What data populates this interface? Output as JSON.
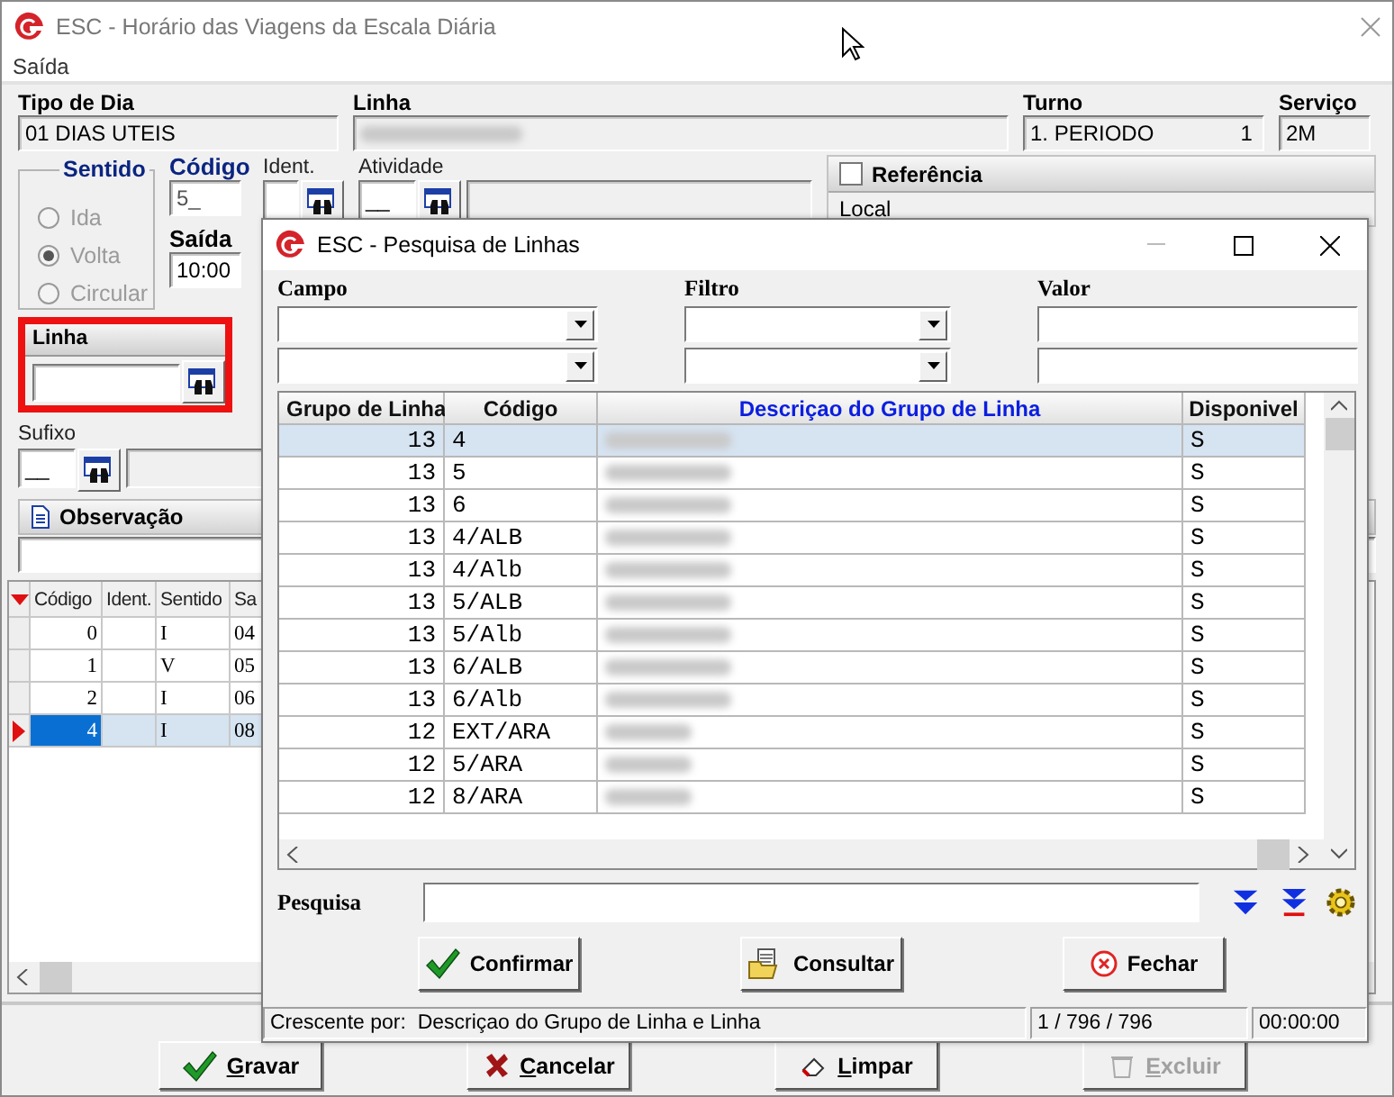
{
  "main_window": {
    "title": "ESC - Horário das Viagens da Escala Diária",
    "menu": [
      "Saída"
    ],
    "header_fields": [
      {
        "label": "Tipo de Dia",
        "value": "01 DIAS UTEIS",
        "blurred": false
      },
      {
        "label": "Linha",
        "blurred": true
      },
      {
        "label": "Turno",
        "value": "1. PERIODO",
        "extra": "1",
        "blurred": false
      },
      {
        "label": "Serviço",
        "value": "2M",
        "blurred": false
      }
    ],
    "sentido": {
      "title": "Sentido",
      "disabled": true,
      "options": [
        {
          "label": "Ida",
          "selected": false
        },
        {
          "label": "Volta",
          "selected": true
        },
        {
          "label": "Circular",
          "selected": false
        }
      ]
    },
    "codigo": {
      "label": "Código",
      "value": "5_"
    },
    "saida": {
      "label": "Saída",
      "value": "10:00"
    },
    "ident": {
      "label": "Ident."
    },
    "atividade": {
      "label": "Atividade",
      "value": "__"
    },
    "referencia": {
      "label": "Referência",
      "checked": false,
      "local": "Local"
    },
    "linha_panel": {
      "title": "Linha",
      "highlighted": true
    },
    "sufixo": {
      "label": "Sufixo",
      "value": "__"
    },
    "observacao": {
      "title": "Observação"
    },
    "grid": {
      "columns": [
        "Código",
        "Ident.",
        "Sentido",
        "Sa"
      ],
      "rows": [
        {
          "codigo": "0",
          "sentido": "I",
          "column_4": "04",
          "selected": false
        },
        {
          "codigo": "1",
          "sentido": "V",
          "column_4": "05",
          "selected": false
        },
        {
          "codigo": "2",
          "sentido": "I",
          "column_4": "06",
          "selected": false
        },
        {
          "codigo": "4",
          "sentido": "I",
          "column_4": "08",
          "selected": true
        }
      ]
    },
    "buttons": [
      {
        "label": "Gravar",
        "kind": "save",
        "disabled": false
      },
      {
        "label": "Cancelar",
        "kind": "cancel",
        "disabled": false
      },
      {
        "label": "Limpar",
        "kind": "clear",
        "disabled": false
      },
      {
        "label": "Excluir",
        "kind": "delete",
        "disabled": true
      }
    ]
  },
  "dialog": {
    "title": "ESC - Pesquisa de Linhas",
    "filter_labels": [
      "Campo",
      "Filtro",
      "Valor"
    ],
    "table": {
      "columns": [
        {
          "label": "Grupo de Linha",
          "sorted": false
        },
        {
          "label": "Código",
          "sorted": false
        },
        {
          "label": "Descriçao do Grupo de Linha",
          "sorted": true
        },
        {
          "label": "Disponivel",
          "sorted": false
        }
      ],
      "rows": [
        {
          "grupo": "13",
          "codigo": "4",
          "disponivel": "S",
          "selected": true
        },
        {
          "grupo": "13",
          "codigo": "5",
          "disponivel": "S",
          "selected": false
        },
        {
          "grupo": "13",
          "codigo": "6",
          "disponivel": "S",
          "selected": false
        },
        {
          "grupo": "13",
          "codigo": "4/ALB",
          "disponivel": "S",
          "selected": false
        },
        {
          "grupo": "13",
          "codigo": "4/Alb",
          "disponivel": "S",
          "selected": false
        },
        {
          "grupo": "13",
          "codigo": "5/ALB",
          "disponivel": "S",
          "selected": false
        },
        {
          "grupo": "13",
          "codigo": "5/Alb",
          "disponivel": "S",
          "selected": false
        },
        {
          "grupo": "13",
          "codigo": "6/ALB",
          "disponivel": "S",
          "selected": false
        },
        {
          "grupo": "13",
          "codigo": "6/Alb",
          "disponivel": "S",
          "selected": false
        },
        {
          "grupo": "12",
          "codigo": "EXT/ARA",
          "disponivel": "S",
          "selected": false
        },
        {
          "grupo": "12",
          "codigo": "5/ARA",
          "disponivel": "S",
          "selected": false
        },
        {
          "grupo": "12",
          "codigo": "8/ARA",
          "disponivel": "S",
          "selected": false
        }
      ]
    },
    "search": {
      "label": "Pesquisa"
    },
    "buttons": [
      {
        "label": "Confirmar",
        "kind": "confirm"
      },
      {
        "label": "Consultar",
        "kind": "query"
      },
      {
        "label": "Fechar",
        "kind": "close"
      }
    ],
    "status_bar": [
      "Crescente por:  Descriçao do Grupo de Linha e Linha",
      "1 / 796 / 796",
      "00:00:00"
    ]
  }
}
